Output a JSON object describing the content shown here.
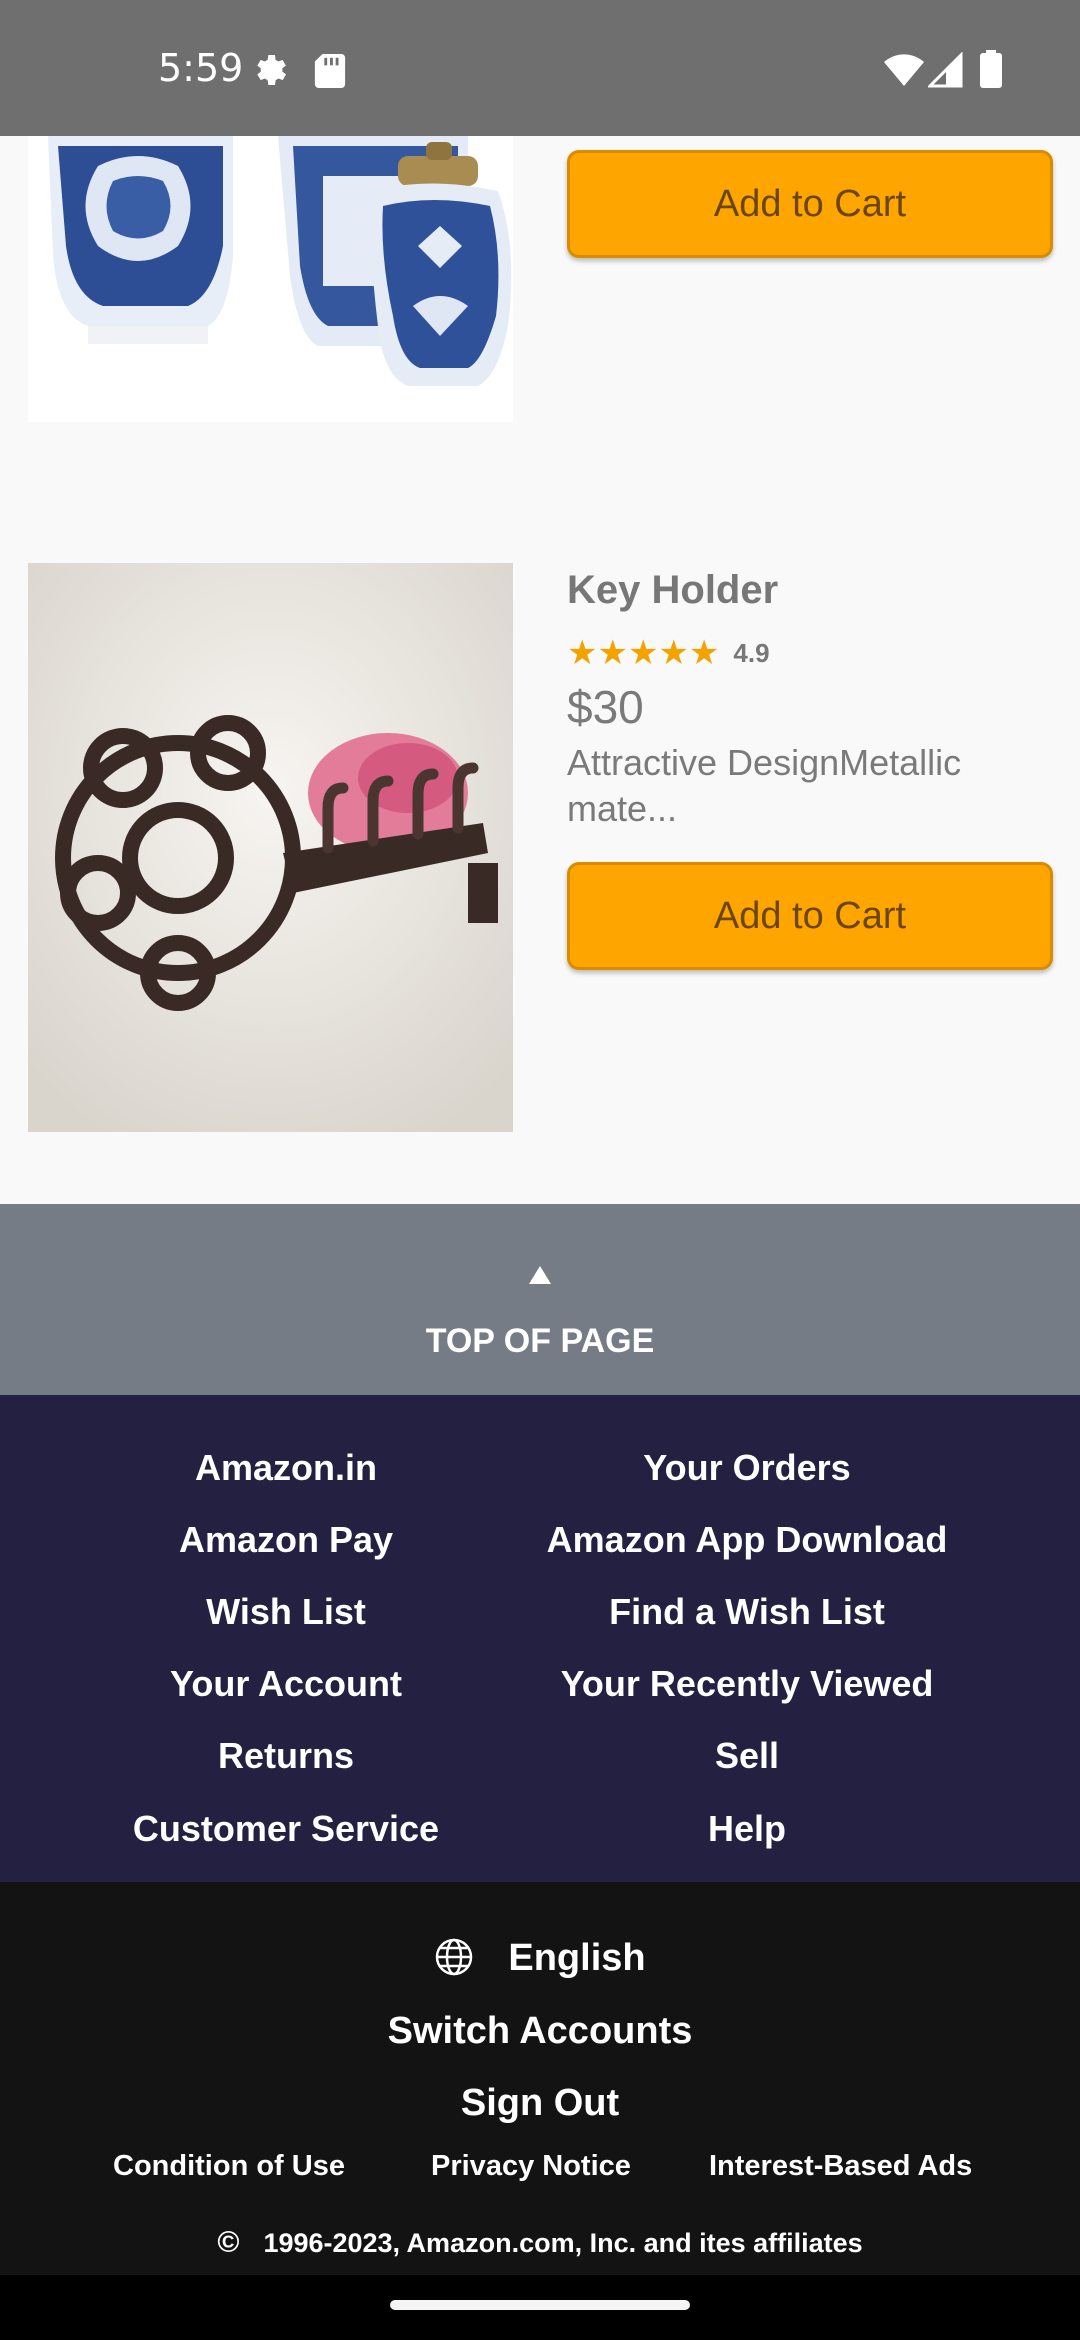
{
  "status_bar": {
    "time": "5:59",
    "icons": [
      "gear-icon",
      "sd-card-icon",
      "wifi-icon",
      "signal-icon",
      "battery-icon"
    ]
  },
  "products": [
    {
      "image": "blue-white-porcelain-jars-image",
      "button_label": "Add to Cart"
    },
    {
      "image": "key-holder-image",
      "title": "Key Holder",
      "stars": "★★★★★",
      "rating": "4.9",
      "price": "$30",
      "description": "Attractive DesignMetallic mate...",
      "button_label": "Add to Cart"
    }
  ],
  "top_of_page": {
    "label": "TOP OF PAGE"
  },
  "footer_links": {
    "col1": [
      "Amazon.in",
      "Amazon Pay",
      "Wish List",
      "Your Account",
      "Returns",
      "Customer Service"
    ],
    "col2": [
      "Your Orders",
      "Amazon App Download",
      "Find a Wish List",
      "Your Recently Viewed",
      "Sell",
      "Help"
    ]
  },
  "footer": {
    "language": "English",
    "switch_accounts": "Switch Accounts",
    "sign_out": "Sign Out",
    "condition_of_use": "Condition of Use",
    "privacy_notice": "Privacy Notice",
    "interest_based_ads": "Interest-Based Ads",
    "copyright_symbol": "©",
    "copyright": "1996-2023, Amazon.com, Inc. and ites affiliates"
  },
  "colors": {
    "status_bar": "#6f6f6f",
    "button": "#ffa500",
    "top_bar": "#767c86",
    "links_bg": "#232041",
    "footer_bg": "#131313"
  }
}
